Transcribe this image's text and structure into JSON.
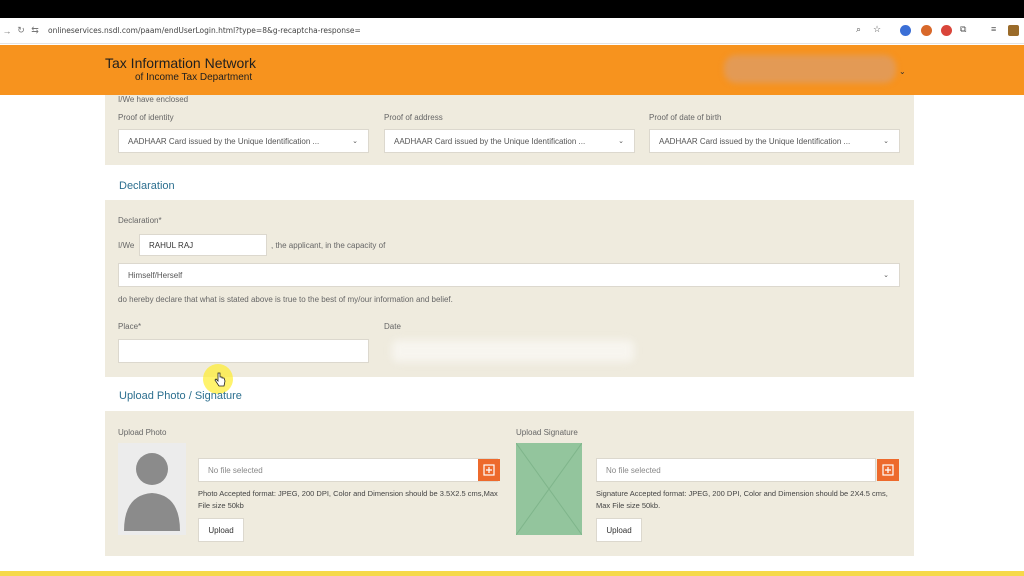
{
  "browser": {
    "url": "onlineservices.nsdl.com/paam/endUserLogin.html?type=8&g-recaptcha-response="
  },
  "header": {
    "title_line1": "Tax Information Network",
    "title_line2": "of Income Tax Department"
  },
  "enclosed": {
    "heading": "I/We have enclosed",
    "proof_identity_label": "Proof of identity",
    "proof_identity_value": "AADHAAR Card issued by the Unique Identification ...",
    "proof_address_label": "Proof of address",
    "proof_address_value": "AADHAAR Card issued by the Unique Identification ...",
    "proof_dob_label": "Proof of date of birth",
    "proof_dob_value": "AADHAAR Card issued by the Unique Identification ..."
  },
  "declaration": {
    "section_title": "Declaration",
    "label": "Declaration*",
    "iwe": "I/We",
    "name_value": "RAHUL RAJ",
    "capacity_text": ", the applicant, in the capacity of",
    "capacity_value": "Himself/Herself",
    "statement": "do hereby declare that what is stated above is true to the best of my/our information and belief.",
    "place_label": "Place*",
    "place_value": "",
    "date_label": "Date"
  },
  "upload": {
    "section_title": "Upload Photo / Signature",
    "photo_label": "Upload Photo",
    "photo_file": "No file selected",
    "photo_note": "Photo Accepted format: JPEG, 200 DPI, Color and Dimension should be 3.5X2.5 cms,Max File size 50kb",
    "photo_button": "Upload",
    "signature_label": "Upload Signature",
    "signature_file": "No file selected",
    "signature_note": "Signature Accepted format: JPEG, 200 DPI, Color and Dimension should be 2X4.5 cms, Max File size 50kb.",
    "signature_button": "Upload"
  },
  "colors": {
    "header": "#f7931e",
    "panel": "#efebde",
    "section_title": "#2c6f8f",
    "file_button": "#ed6a2c"
  }
}
